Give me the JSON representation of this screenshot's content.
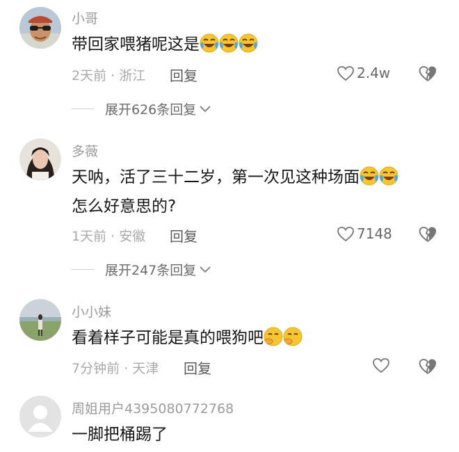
{
  "comments": [
    {
      "user": "小哥",
      "text": "带回家喂猪呢这是",
      "time_location": "2天前 · 浙江",
      "reply_label": "回复",
      "likes": "2.4w",
      "expand_label": "展开626条回复"
    },
    {
      "user": "多薇",
      "text_line1": "天呐，活了三十二岁，第一次见这种场面",
      "text_line2": "怎么好意思的?",
      "time_location": "1天前 · 安徽",
      "reply_label": "回复",
      "likes": "7148",
      "expand_label": "展开247条回复"
    },
    {
      "user": "小小妹",
      "text": "看着样子可能是真的喂狗吧",
      "time_location": "7分钟前 · 天津",
      "reply_label": "回复"
    },
    {
      "user": "周姐用户4395080772768",
      "text": "一脚把桶踢了"
    }
  ],
  "icons": {
    "like": "heart-outline-icon",
    "dislike": "broken-heart-icon",
    "expand": "chevron-down-icon",
    "emoji_laugh": "tears-of-joy-emoji",
    "emoji_smirk": "hand-over-mouth-emoji"
  },
  "colors": {
    "name": "#9b9b9b",
    "text": "#161616",
    "meta": "#a9a9a9",
    "emoji": "#f7c531"
  }
}
